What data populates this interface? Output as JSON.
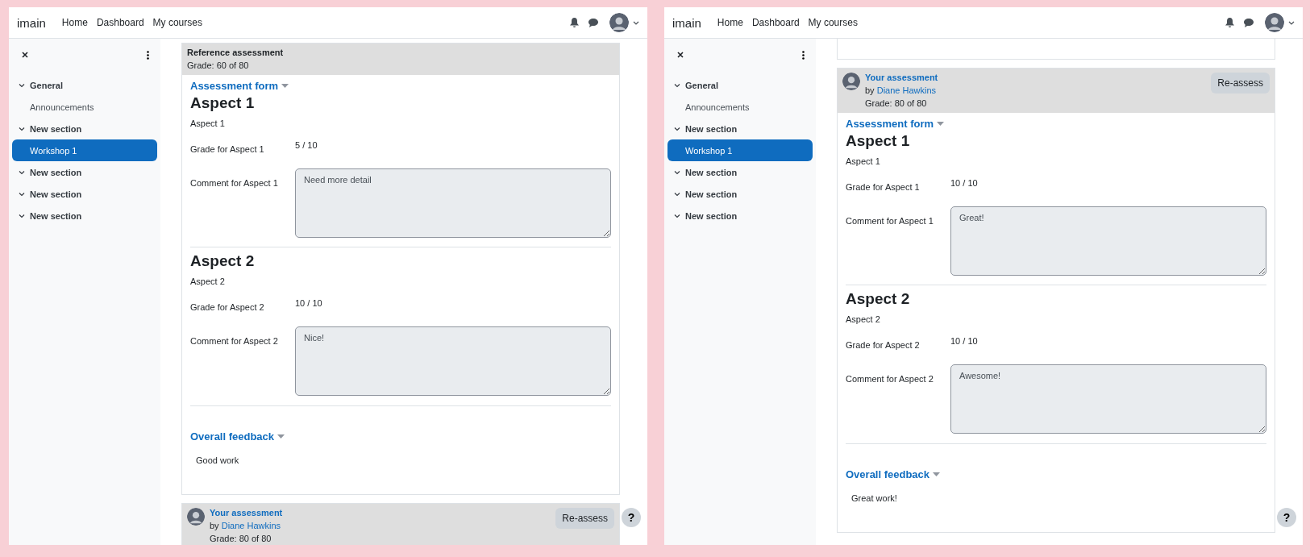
{
  "screens": [
    {
      "navbar": {
        "brand": "imain",
        "links": [
          "Home",
          "Dashboard",
          "My courses"
        ]
      },
      "sidebar": {
        "items": [
          {
            "label": "General",
            "kind": "section",
            "expanded": true,
            "selected": false
          },
          {
            "label": "Announcements",
            "kind": "activity",
            "selected": false
          },
          {
            "label": "New section",
            "kind": "section",
            "expanded": true,
            "selected": false
          },
          {
            "label": "Workshop 1",
            "kind": "activity",
            "selected": true
          },
          {
            "label": "New section",
            "kind": "section",
            "expanded": true,
            "selected": false
          },
          {
            "label": "New section",
            "kind": "section",
            "expanded": true,
            "selected": false
          },
          {
            "label": "New section",
            "kind": "section",
            "expanded": true,
            "selected": false
          }
        ]
      },
      "cards": [
        {
          "kind": "reference",
          "title": "Reference assessment",
          "grade": "Grade: 60 of 80",
          "form": {
            "heading": "Assessment form",
            "aspects": [
              {
                "title": "Aspect 1",
                "description": "Aspect 1",
                "grade_label": "Grade for Aspect 1",
                "grade": "5 / 10",
                "comment_label": "Comment for Aspect 1",
                "comment": "Need more detail"
              },
              {
                "title": "Aspect 2",
                "description": "Aspect 2",
                "grade_label": "Grade for Aspect 2",
                "grade": "10 / 10",
                "comment_label": "Comment for Aspect 2",
                "comment": "Nice!"
              }
            ],
            "feedback_heading": "Overall feedback",
            "feedback": "Good work"
          }
        },
        {
          "kind": "own",
          "title": "Your assessment",
          "by": "by",
          "author": "Diane Hawkins",
          "grade": "Grade: 80 of 80",
          "button": "Re-assess"
        }
      ],
      "help_button": "?"
    },
    {
      "navbar": {
        "brand": "imain",
        "links": [
          "Home",
          "Dashboard",
          "My courses"
        ]
      },
      "sidebar": {
        "items": [
          {
            "label": "General",
            "kind": "section",
            "expanded": true,
            "selected": false
          },
          {
            "label": "Announcements",
            "kind": "activity",
            "selected": false
          },
          {
            "label": "New section",
            "kind": "section",
            "expanded": true,
            "selected": false
          },
          {
            "label": "Workshop 1",
            "kind": "activity",
            "selected": true
          },
          {
            "label": "New section",
            "kind": "section",
            "expanded": true,
            "selected": false
          },
          {
            "label": "New section",
            "kind": "section",
            "expanded": true,
            "selected": false
          },
          {
            "label": "New section",
            "kind": "section",
            "expanded": true,
            "selected": false
          }
        ]
      },
      "cards": [
        {
          "kind": "stub"
        },
        {
          "kind": "own",
          "title": "Your assessment",
          "by": "by",
          "author": "Diane Hawkins",
          "grade": "Grade: 80 of 80",
          "button": "Re-assess",
          "form": {
            "heading": "Assessment form",
            "aspects": [
              {
                "title": "Aspect 1",
                "description": "Aspect 1",
                "grade_label": "Grade for Aspect 1",
                "grade": "10 / 10",
                "comment_label": "Comment for Aspect 1",
                "comment": "Great!"
              },
              {
                "title": "Aspect 2",
                "description": "Aspect 2",
                "grade_label": "Grade for Aspect 2",
                "grade": "10 / 10",
                "comment_label": "Comment for Aspect 2",
                "comment": "Awesome!"
              }
            ],
            "feedback_heading": "Overall feedback",
            "feedback": "Great work!"
          }
        }
      ],
      "help_button": "?"
    }
  ]
}
